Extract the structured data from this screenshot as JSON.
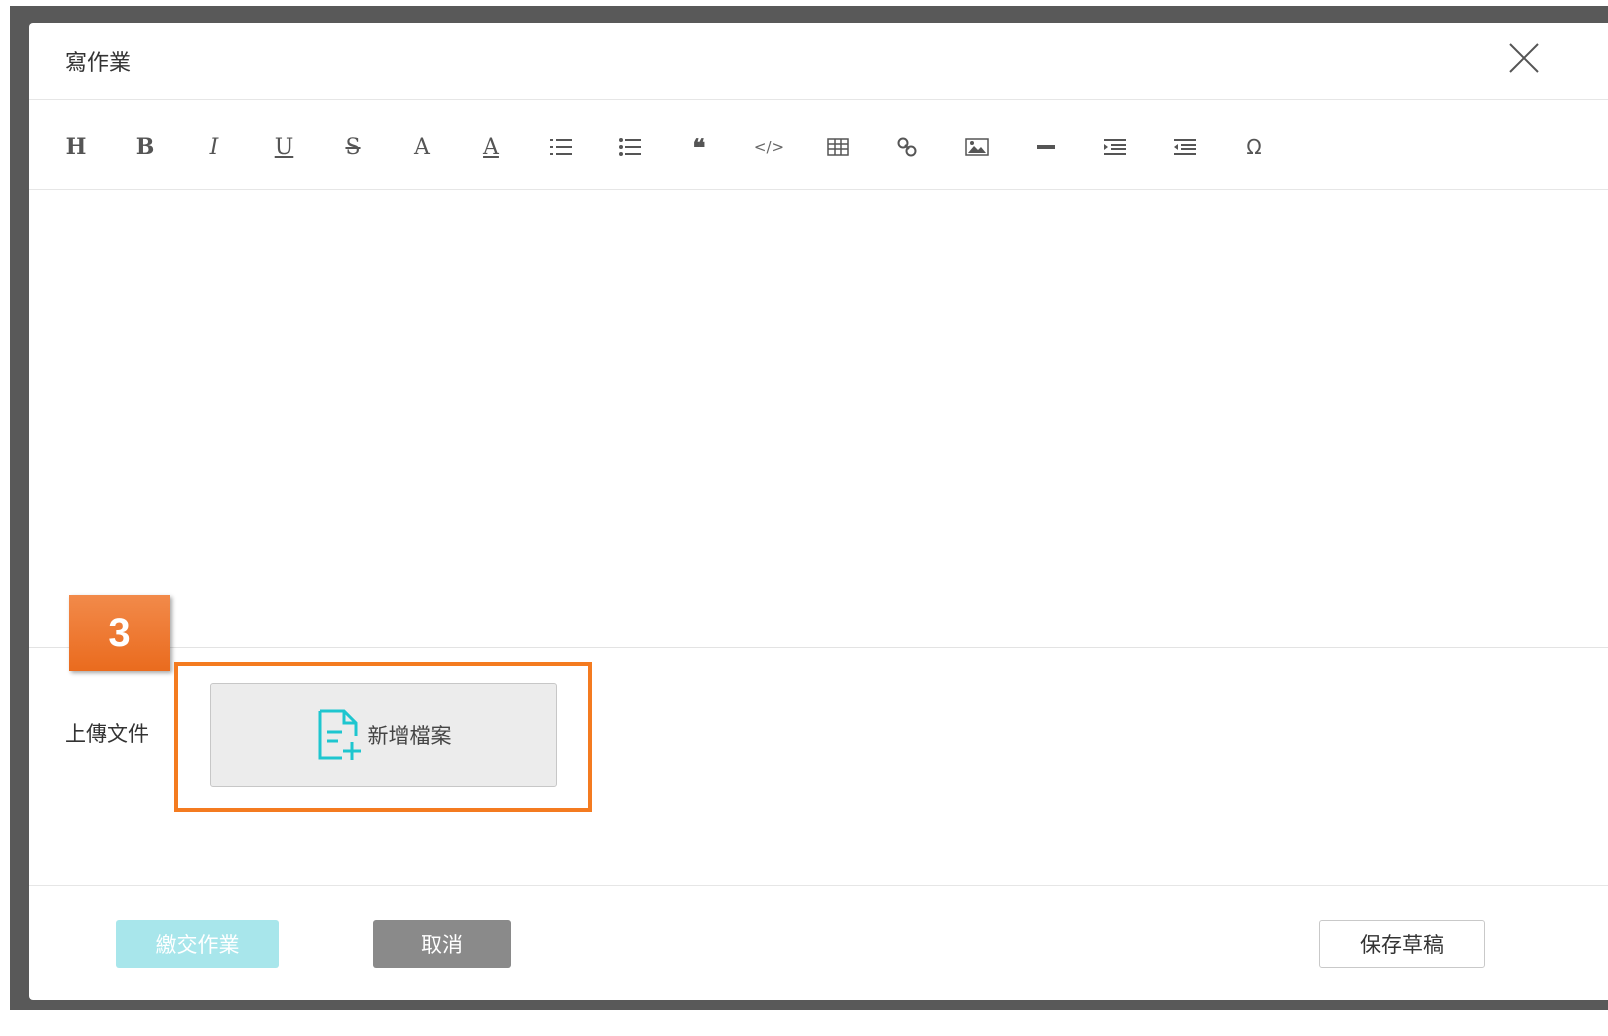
{
  "modal": {
    "title": "寫作業"
  },
  "toolbar": {
    "tools": [
      {
        "name": "heading",
        "glyph": "H"
      },
      {
        "name": "bold",
        "glyph": "B"
      },
      {
        "name": "italic",
        "glyph": "I"
      },
      {
        "name": "underline",
        "glyph": "U"
      },
      {
        "name": "strikethrough",
        "glyph": "S"
      },
      {
        "name": "font-color",
        "glyph": "A"
      },
      {
        "name": "background-color",
        "glyph": "A"
      },
      {
        "name": "ordered-list",
        "glyph": ""
      },
      {
        "name": "unordered-list",
        "glyph": ""
      },
      {
        "name": "blockquote",
        "glyph": "❝"
      },
      {
        "name": "code",
        "glyph": "</>"
      },
      {
        "name": "table",
        "glyph": ""
      },
      {
        "name": "link",
        "glyph": ""
      },
      {
        "name": "image",
        "glyph": ""
      },
      {
        "name": "horizontal-rule",
        "glyph": ""
      },
      {
        "name": "indent",
        "glyph": ""
      },
      {
        "name": "outdent",
        "glyph": ""
      },
      {
        "name": "special-char",
        "glyph": "Ω"
      }
    ]
  },
  "upload": {
    "label": "上傳文件",
    "add_file_label": "新增檔案",
    "step_number": "3"
  },
  "footer": {
    "submit_label": "繳交作業",
    "cancel_label": "取消",
    "save_draft_label": "保存草稿"
  },
  "colors": {
    "accent": "#1ec6cf",
    "highlight": "#f47b20",
    "submit_disabled": "#a8e6eb",
    "cancel": "#8a8a8a"
  }
}
